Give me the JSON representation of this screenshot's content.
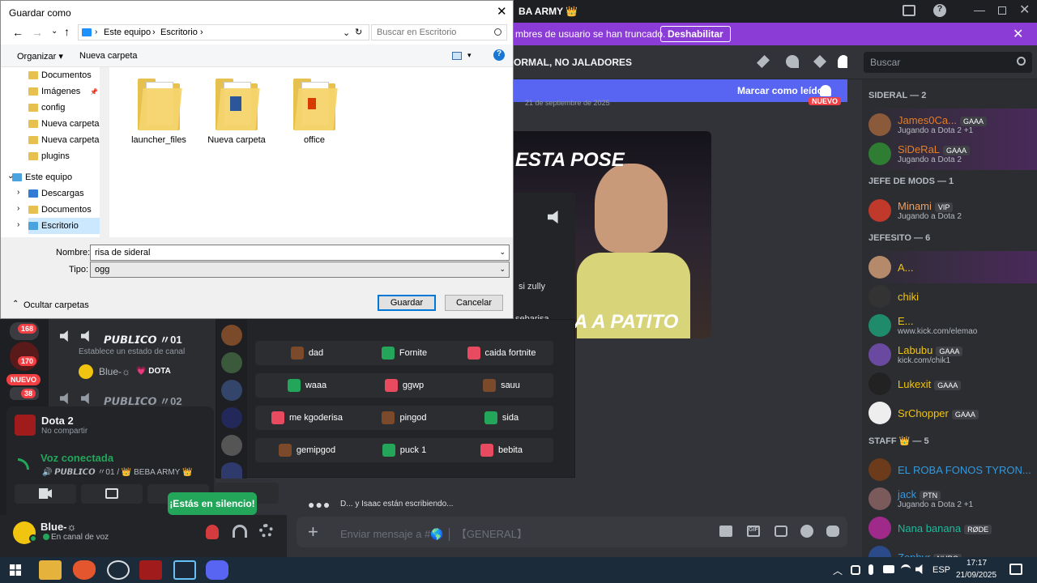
{
  "dialog": {
    "title": "Guardar como",
    "breadcrumb": [
      "Este equipo",
      "Escritorio"
    ],
    "search_placeholder": "Buscar en Escritorio",
    "organize": "Organizar",
    "new_folder": "Nueva carpeta",
    "tree": [
      {
        "label": "Documentos",
        "pinned": true
      },
      {
        "label": "Imágenes",
        "pinned": true
      },
      {
        "label": "config"
      },
      {
        "label": "Nueva carpeta"
      },
      {
        "label": "Nueva carpeta"
      },
      {
        "label": "plugins"
      },
      {
        "label": "Este equipo"
      },
      {
        "label": "Descargas"
      },
      {
        "label": "Documentos"
      },
      {
        "label": "Escritorio"
      }
    ],
    "folders": [
      "launcher_files",
      "Nueva carpeta",
      "office"
    ],
    "name_label": "Nombre:",
    "name_value": "risa de sideral",
    "type_label": "Tipo:",
    "type_value": "ogg",
    "hide_folders": "Ocultar carpetas",
    "save": "Guardar",
    "cancel": "Cancelar"
  },
  "discord": {
    "window_title": "BA ARMY 👑",
    "notice": "mbres de usuario se han truncado.",
    "notice_button": "Deshabilitar",
    "channel_name": "ORMAL, NO JALADORES",
    "search_placeholder": "Buscar",
    "mark_read": "Marcar como leído",
    "date_divider": "21 de septiembre de 2025",
    "new_badge": "NUEVO",
    "video_top": "ESTA POSE",
    "video_bottom": "A A PATITO",
    "typing": "D... y Isaac están escribiendo...",
    "composer_placeholder": "Enviar mensaje a #🌎 │ 【GENERAL】",
    "voice_channels": [
      {
        "name": "𝙋𝙐𝘽𝙇𝙄𝘾𝙊 〃01",
        "status": "Establece un estado de canal"
      },
      {
        "name": "𝙋𝙐𝘽𝙇𝙄𝘾𝙊 〃02"
      }
    ],
    "voice_user": "Blue-☼",
    "voice_user_tag": "💗 DOTA",
    "activity_game": "Dota 2",
    "activity_sub": "No compartir",
    "voice_connected": "Voz conectada",
    "voice_location": "🔊 𝙋𝙐𝘽𝙇𝙄𝘾𝙊 〃01 / 👑 BEBA ARMY 👑",
    "muted_toast": "¡Estás en silencio!",
    "user_name": "Blue-☼",
    "user_status": "En canal de voz",
    "server_badges": [
      "168",
      "170",
      "NUEVO",
      "38"
    ],
    "soundboard_partial": [
      "si zully",
      "sebarisa"
    ],
    "soundboard": [
      [
        "dad",
        "Fornite",
        "caida fortnite"
      ],
      [
        "waaa",
        "ggwp",
        "sauu"
      ],
      [
        "me kgoderisa",
        "pingod",
        "sida"
      ],
      [
        "gemipgod",
        "puck 1",
        "bebita"
      ]
    ],
    "member_groups": [
      {
        "title": "SIDERAL — 2",
        "members": [
          {
            "name": "James0Ca...",
            "tag": "GAAA",
            "sub": "Jugando a Dota 2 +1",
            "color": "#e67e22"
          },
          {
            "name": "SiDeRaL",
            "tag": "GAAA",
            "sub": "Jugando a Dota 2",
            "color": "#e67e22"
          }
        ]
      },
      {
        "title": "JEFE DE MODS — 1",
        "members": [
          {
            "name": "Minami",
            "tag": "VIP",
            "sub": "Jugando a Dota 2",
            "color": "#f1a05a"
          }
        ]
      },
      {
        "title": "JEFESITO — 6",
        "members": [
          {
            "name": "A...",
            "tag": "",
            "sub": "",
            "color": "#f1c40f"
          },
          {
            "name": "chiki",
            "tag": "",
            "sub": "",
            "color": "#f1c40f"
          },
          {
            "name": "E...",
            "tag": "",
            "sub": "www.kick.com/elemao",
            "color": "#f1c40f"
          },
          {
            "name": "Labubu",
            "tag": "GAAA",
            "sub": "kick.com/chik1",
            "color": "#f1c40f"
          },
          {
            "name": "Lukexit",
            "tag": "GAAA",
            "sub": "",
            "color": "#f1c40f"
          },
          {
            "name": "SrChopper",
            "tag": "GAAA",
            "sub": "",
            "color": "#f1c40f"
          }
        ]
      },
      {
        "title": "STAFF 👑 — 5",
        "members": [
          {
            "name": "EL ROBA FONOS TYRON...",
            "tag": "",
            "sub": "",
            "color": "#3498db"
          },
          {
            "name": "jack",
            "tag": "PTN",
            "sub": "Jugando a Dota 2 +1",
            "color": "#3498db"
          },
          {
            "name": "Nana banana",
            "tag": "RØDE",
            "sub": "",
            "color": "#1abc9c"
          },
          {
            "name": "Zephyr",
            "tag": "NURO",
            "sub": "",
            "color": "#3498db"
          }
        ]
      }
    ]
  },
  "taskbar": {
    "lang": "ESP",
    "time": "17:17",
    "date": "21/09/2025"
  },
  "colors": {
    "accent": "#5865f2",
    "notice": "#8b3bd6",
    "save_border": "#0078d7"
  }
}
